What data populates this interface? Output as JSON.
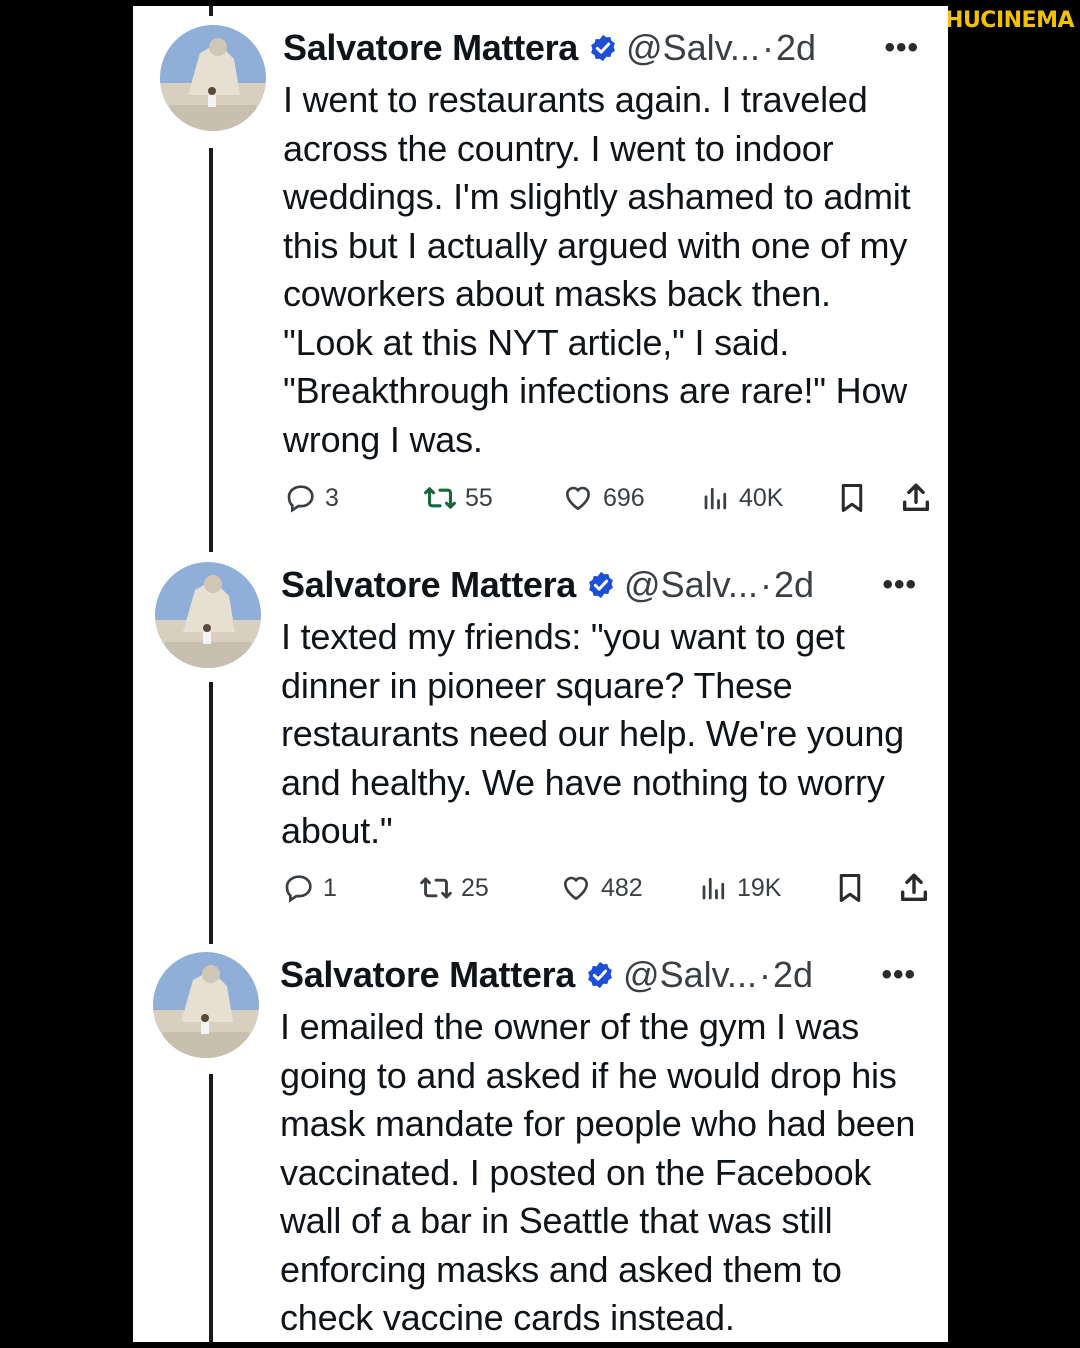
{
  "watermark": "GETHUCINEMA",
  "colors": {
    "background": "#000000",
    "card": "#ffffff",
    "text": "#0f1419",
    "secondary": "#3a3f44",
    "verified": "#1d4ed8",
    "watermark": "#f2c200"
  },
  "tweets": [
    {
      "name": "Salvatore Mattera",
      "handle": "@Salv...",
      "dot": "·",
      "time": "2d",
      "more": "•••",
      "text": "I went to restaurants again. I traveled across the country. I went to indoor weddings. I'm slightly ashamed to admit this but I actually argued with one of my coworkers about masks back then. \"Look at this NYT article,\" I said. \"Breakthrough infections are rare!\" How wrong I was.",
      "replies": "3",
      "reposts": "55",
      "likes": "696",
      "views": "40K"
    },
    {
      "name": "Salvatore Mattera",
      "handle": "@Salv...",
      "dot": "·",
      "time": "2d",
      "more": "•••",
      "text": "I texted my friends: \"you want to get dinner in pioneer square? These restaurants need our help. We're young and healthy. We have nothing to worry about.\"",
      "replies": "1",
      "reposts": "25",
      "likes": "482",
      "views": "19K"
    },
    {
      "name": "Salvatore Mattera",
      "handle": "@Salv...",
      "dot": "·",
      "time": "2d",
      "more": "•••",
      "text": "I emailed the owner of the gym I was going to and asked if he would drop his mask mandate for people who had been vaccinated. I posted on the Facebook wall of a bar in Seattle that was still enforcing masks and asked them to check vaccine cards instead."
    }
  ],
  "icons": {
    "reply": "reply-icon",
    "repost": "repost-icon",
    "like": "heart-icon",
    "views": "views-icon",
    "bookmark": "bookmark-icon",
    "share": "share-icon",
    "verified": "verified-badge-icon"
  }
}
